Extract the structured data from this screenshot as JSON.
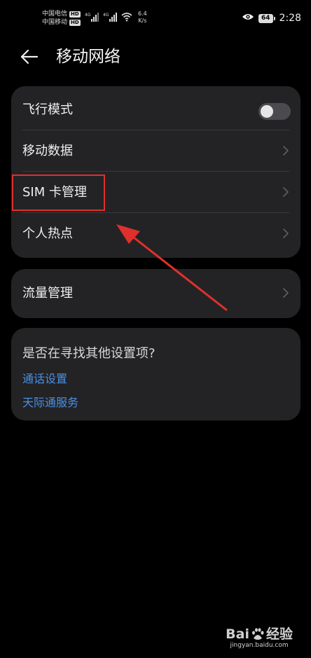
{
  "status_bar": {
    "carrier_1": "中国电信",
    "carrier_2": "中国移动",
    "hd_label": "HD",
    "net_type_1": "4G",
    "net_type_2": "4G",
    "net_speed_value": "6.4",
    "net_speed_unit": "K/s",
    "battery": "64",
    "time": "2:28"
  },
  "header": {
    "title": "移动网络"
  },
  "main_settings": {
    "items": [
      {
        "label": "飞行模式",
        "toggle_on": false
      },
      {
        "label": "移动数据"
      },
      {
        "label": "SIM 卡管理"
      },
      {
        "label": "个人热点"
      }
    ]
  },
  "traffic": {
    "label": "流量管理"
  },
  "suggestions": {
    "title": "是否在寻找其他设置项?",
    "links": [
      "通话设置",
      "天际通服务"
    ]
  },
  "watermark": {
    "brand": "Bai",
    "brand_suffix": "经验",
    "url": "jingyan.baidu.com"
  },
  "colors": {
    "background": "#000000",
    "card": "#232325",
    "link": "#4a90e8",
    "highlight": "#e0302c"
  }
}
